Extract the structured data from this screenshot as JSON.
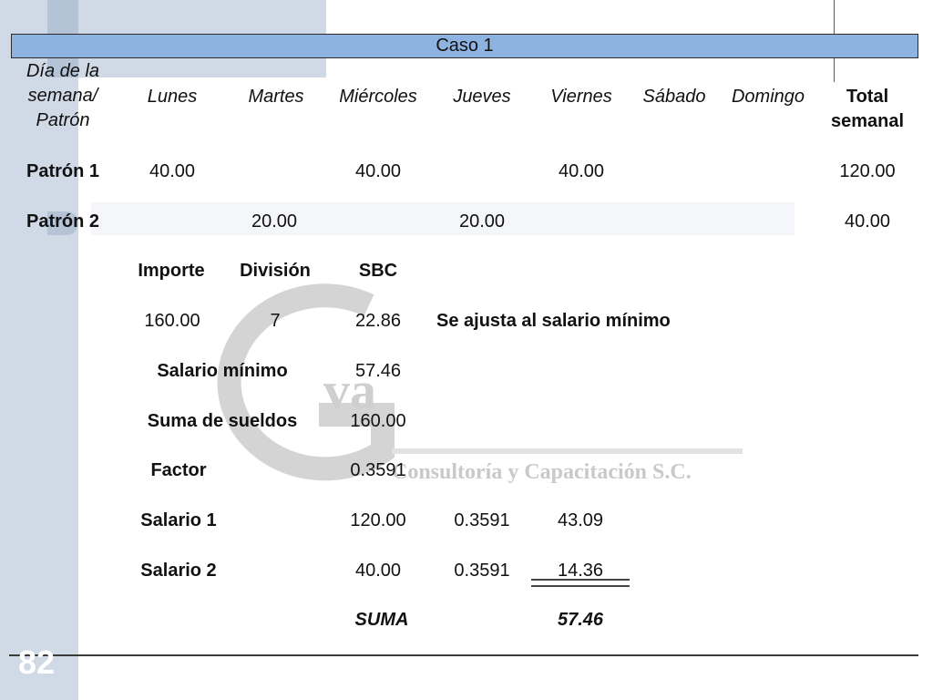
{
  "title": "Caso 1",
  "page_number": "82",
  "watermark": {
    "mark_text": "va",
    "company": "Consultoría y Capacitación S.C."
  },
  "header": {
    "col0_line1": "Día de la",
    "col0_line2": "semana/",
    "col0_line3": "Patrón",
    "days": [
      "Lunes",
      "Martes",
      "Miércoles",
      "Jueves",
      "Viernes",
      "Sábado",
      "Domingo"
    ],
    "total_line1": "Total",
    "total_line2": "semanal"
  },
  "rows": [
    {
      "label": "Patrón 1",
      "lunes": "40.00",
      "miercoles": "40.00",
      "viernes": "40.00",
      "total": "120.00"
    },
    {
      "label": "Patrón 2",
      "martes": "20.00",
      "jueves": "20.00",
      "total": "40.00"
    }
  ],
  "calc": {
    "importe_label": "Importe",
    "division_label": "División",
    "sbc_label": "SBC",
    "importe": "160.00",
    "division": "7",
    "sbc": "22.86",
    "note": "Se ajusta al salario mínimo",
    "salario_minimo_label": "Salario mínimo",
    "salario_minimo": "57.46",
    "suma_sueldos_label": "Suma de sueldos",
    "suma_sueldos": "160.00",
    "factor_label": "Factor",
    "factor": "0.3591",
    "salario1_label": "Salario 1",
    "salario1_base": "120.00",
    "salario1_factor": "0.3591",
    "salario1_result": "43.09",
    "salario2_label": "Salario 2",
    "salario2_base": "40.00",
    "salario2_factor": "0.3591",
    "salario2_result": "14.36",
    "suma_label": "SUMA",
    "suma_value": "57.46"
  }
}
